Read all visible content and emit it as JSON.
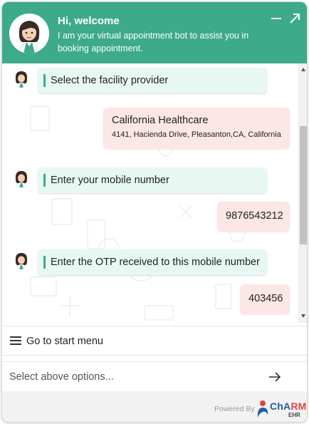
{
  "header": {
    "title": "Hi, welcome",
    "subtitle": "I am your virtual appointment bot to assist you in booking appointment.",
    "minimize_icon": "minus-icon",
    "expand_icon": "expand-arrow-icon"
  },
  "messages": [
    {
      "from": "bot",
      "text": "Select the facility provider"
    },
    {
      "from": "user",
      "text": "California Healthcare",
      "subtext": "4141, Hacienda Drive, Pleasanton,CA, California"
    },
    {
      "from": "bot",
      "text": "Enter your mobile number"
    },
    {
      "from": "user",
      "text": "9876543212"
    },
    {
      "from": "bot",
      "text": "Enter the OTP received to this mobile number"
    },
    {
      "from": "user",
      "text": "403456"
    }
  ],
  "start_menu": {
    "label": "Go to start menu",
    "icon": "hamburger-icon"
  },
  "input": {
    "placeholder": "Select above options...",
    "value": "",
    "send_icon": "arrow-right-icon"
  },
  "footer": {
    "powered_by": "Powered By",
    "logo_main": "ChA",
    "logo_accent": "RM",
    "logo_sub": "EHR"
  },
  "colors": {
    "header": "#3daa8a",
    "bot_bubble": "#e7f8f3",
    "user_bubble": "#fde6e6",
    "accent_bar": "#3daa8a"
  }
}
